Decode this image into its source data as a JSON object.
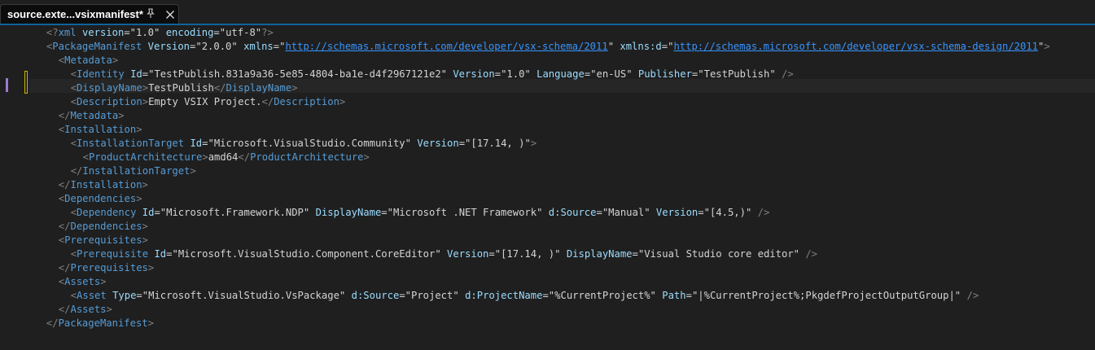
{
  "tab": {
    "title": "source.exte...vsixmanifest*",
    "pin_icon": "pin-icon",
    "close_icon": "close-icon"
  },
  "colors": {
    "tag": "#569cd6",
    "attribute": "#9cdcfe",
    "bracket": "#808080",
    "link": "#3794ff",
    "text": "#d4d4d4",
    "tab_accent": "#0e639c"
  },
  "code_lines": [
    {
      "indent": 2,
      "tokens": [
        [
          "br",
          "<?"
        ],
        [
          "tag",
          "xml"
        ],
        [
          "sp",
          " "
        ],
        [
          "attr",
          "version"
        ],
        [
          "eq",
          "="
        ],
        [
          "q",
          "\""
        ],
        [
          "val",
          "1.0"
        ],
        [
          "q",
          "\""
        ],
        [
          "sp",
          " "
        ],
        [
          "attr",
          "encoding"
        ],
        [
          "eq",
          "="
        ],
        [
          "q",
          "\""
        ],
        [
          "val",
          "utf-8"
        ],
        [
          "q",
          "\""
        ],
        [
          "br",
          "?>"
        ]
      ]
    },
    {
      "indent": 2,
      "tokens": [
        [
          "br",
          "<"
        ],
        [
          "tag",
          "PackageManifest"
        ],
        [
          "sp",
          " "
        ],
        [
          "attr",
          "Version"
        ],
        [
          "eq",
          "="
        ],
        [
          "q",
          "\""
        ],
        [
          "val",
          "2.0.0"
        ],
        [
          "q",
          "\""
        ],
        [
          "sp",
          " "
        ],
        [
          "attr",
          "xmlns"
        ],
        [
          "eq",
          "="
        ],
        [
          "q",
          "\""
        ],
        [
          "link",
          "http://schemas.microsoft.com/developer/vsx-schema/2011"
        ],
        [
          "q",
          "\""
        ],
        [
          "sp",
          " "
        ],
        [
          "attr",
          "xmlns:d"
        ],
        [
          "eq",
          "="
        ],
        [
          "q",
          "\""
        ],
        [
          "link",
          "http://schemas.microsoft.com/developer/vsx-schema-design/2011"
        ],
        [
          "q",
          "\""
        ],
        [
          "br",
          ">"
        ]
      ]
    },
    {
      "indent": 4,
      "tokens": [
        [
          "br",
          "<"
        ],
        [
          "tag",
          "Metadata"
        ],
        [
          "br",
          ">"
        ]
      ]
    },
    {
      "indent": 6,
      "tokens": [
        [
          "br",
          "<"
        ],
        [
          "tag",
          "Identity"
        ],
        [
          "sp",
          " "
        ],
        [
          "attr",
          "Id"
        ],
        [
          "eq",
          "="
        ],
        [
          "q",
          "\""
        ],
        [
          "val",
          "TestPublish.831a9a36-5e85-4804-ba1e-d4f2967121e2"
        ],
        [
          "q",
          "\""
        ],
        [
          "sp",
          " "
        ],
        [
          "attr",
          "Version"
        ],
        [
          "eq",
          "="
        ],
        [
          "q",
          "\""
        ],
        [
          "val",
          "1.0"
        ],
        [
          "q",
          "\""
        ],
        [
          "sp",
          " "
        ],
        [
          "attr",
          "Language"
        ],
        [
          "eq",
          "="
        ],
        [
          "q",
          "\""
        ],
        [
          "val",
          "en-US"
        ],
        [
          "q",
          "\""
        ],
        [
          "sp",
          " "
        ],
        [
          "attr",
          "Publisher"
        ],
        [
          "eq",
          "="
        ],
        [
          "q",
          "\""
        ],
        [
          "val",
          "TestPublish"
        ],
        [
          "q",
          "\""
        ],
        [
          "sp",
          " "
        ],
        [
          "br",
          "/>"
        ]
      ]
    },
    {
      "indent": 6,
      "tokens": [
        [
          "br",
          "<"
        ],
        [
          "tag",
          "DisplayName"
        ],
        [
          "br",
          ">"
        ],
        [
          "text",
          "TestPublish"
        ],
        [
          "br",
          "</"
        ],
        [
          "tag",
          "DisplayName"
        ],
        [
          "br",
          ">"
        ]
      ]
    },
    {
      "indent": 6,
      "tokens": [
        [
          "br",
          "<"
        ],
        [
          "tag",
          "Description"
        ],
        [
          "br",
          ">"
        ],
        [
          "text",
          "Empty VSIX Project."
        ],
        [
          "br",
          "</"
        ],
        [
          "tag",
          "Description"
        ],
        [
          "br",
          ">"
        ]
      ]
    },
    {
      "indent": 4,
      "tokens": [
        [
          "br",
          "</"
        ],
        [
          "tag",
          "Metadata"
        ],
        [
          "br",
          ">"
        ]
      ]
    },
    {
      "indent": 4,
      "tokens": [
        [
          "br",
          "<"
        ],
        [
          "tag",
          "Installation"
        ],
        [
          "br",
          ">"
        ]
      ]
    },
    {
      "indent": 6,
      "tokens": [
        [
          "br",
          "<"
        ],
        [
          "tag",
          "InstallationTarget"
        ],
        [
          "sp",
          " "
        ],
        [
          "attr",
          "Id"
        ],
        [
          "eq",
          "="
        ],
        [
          "q",
          "\""
        ],
        [
          "val",
          "Microsoft.VisualStudio.Community"
        ],
        [
          "q",
          "\""
        ],
        [
          "sp",
          " "
        ],
        [
          "attr",
          "Version"
        ],
        [
          "eq",
          "="
        ],
        [
          "q",
          "\""
        ],
        [
          "val",
          "[17.14, )"
        ],
        [
          "q",
          "\""
        ],
        [
          "br",
          ">"
        ]
      ]
    },
    {
      "indent": 8,
      "tokens": [
        [
          "br",
          "<"
        ],
        [
          "tag",
          "ProductArchitecture"
        ],
        [
          "br",
          ">"
        ],
        [
          "text",
          "amd64"
        ],
        [
          "br",
          "</"
        ],
        [
          "tag",
          "ProductArchitecture"
        ],
        [
          "br",
          ">"
        ]
      ]
    },
    {
      "indent": 6,
      "tokens": [
        [
          "br",
          "</"
        ],
        [
          "tag",
          "InstallationTarget"
        ],
        [
          "br",
          ">"
        ]
      ]
    },
    {
      "indent": 4,
      "tokens": [
        [
          "br",
          "</"
        ],
        [
          "tag",
          "Installation"
        ],
        [
          "br",
          ">"
        ]
      ]
    },
    {
      "indent": 4,
      "tokens": [
        [
          "br",
          "<"
        ],
        [
          "tag",
          "Dependencies"
        ],
        [
          "br",
          ">"
        ]
      ]
    },
    {
      "indent": 6,
      "tokens": [
        [
          "br",
          "<"
        ],
        [
          "tag",
          "Dependency"
        ],
        [
          "sp",
          " "
        ],
        [
          "attr",
          "Id"
        ],
        [
          "eq",
          "="
        ],
        [
          "q",
          "\""
        ],
        [
          "val",
          "Microsoft.Framework.NDP"
        ],
        [
          "q",
          "\""
        ],
        [
          "sp",
          " "
        ],
        [
          "attr",
          "DisplayName"
        ],
        [
          "eq",
          "="
        ],
        [
          "q",
          "\""
        ],
        [
          "val",
          "Microsoft .NET Framework"
        ],
        [
          "q",
          "\""
        ],
        [
          "sp",
          " "
        ],
        [
          "attr",
          "d:Source"
        ],
        [
          "eq",
          "="
        ],
        [
          "q",
          "\""
        ],
        [
          "val",
          "Manual"
        ],
        [
          "q",
          "\""
        ],
        [
          "sp",
          " "
        ],
        [
          "attr",
          "Version"
        ],
        [
          "eq",
          "="
        ],
        [
          "q",
          "\""
        ],
        [
          "val",
          "[4.5,)"
        ],
        [
          "q",
          "\""
        ],
        [
          "sp",
          " "
        ],
        [
          "br",
          "/>"
        ]
      ]
    },
    {
      "indent": 4,
      "tokens": [
        [
          "br",
          "</"
        ],
        [
          "tag",
          "Dependencies"
        ],
        [
          "br",
          ">"
        ]
      ]
    },
    {
      "indent": 4,
      "tokens": [
        [
          "br",
          "<"
        ],
        [
          "tag",
          "Prerequisites"
        ],
        [
          "br",
          ">"
        ]
      ]
    },
    {
      "indent": 6,
      "tokens": [
        [
          "br",
          "<"
        ],
        [
          "tag",
          "Prerequisite"
        ],
        [
          "sp",
          " "
        ],
        [
          "attr",
          "Id"
        ],
        [
          "eq",
          "="
        ],
        [
          "q",
          "\""
        ],
        [
          "val",
          "Microsoft.VisualStudio.Component.CoreEditor"
        ],
        [
          "q",
          "\""
        ],
        [
          "sp",
          " "
        ],
        [
          "attr",
          "Version"
        ],
        [
          "eq",
          "="
        ],
        [
          "q",
          "\""
        ],
        [
          "val",
          "[17.14, )"
        ],
        [
          "q",
          "\""
        ],
        [
          "sp",
          " "
        ],
        [
          "attr",
          "DisplayName"
        ],
        [
          "eq",
          "="
        ],
        [
          "q",
          "\""
        ],
        [
          "val",
          "Visual Studio core editor"
        ],
        [
          "q",
          "\""
        ],
        [
          "sp",
          " "
        ],
        [
          "br",
          "/>"
        ]
      ]
    },
    {
      "indent": 4,
      "tokens": [
        [
          "br",
          "</"
        ],
        [
          "tag",
          "Prerequisites"
        ],
        [
          "br",
          ">"
        ]
      ]
    },
    {
      "indent": 4,
      "tokens": [
        [
          "br",
          "<"
        ],
        [
          "tag",
          "Assets"
        ],
        [
          "br",
          ">"
        ]
      ]
    },
    {
      "indent": 6,
      "tokens": [
        [
          "br",
          "<"
        ],
        [
          "tag",
          "Asset"
        ],
        [
          "sp",
          " "
        ],
        [
          "attr",
          "Type"
        ],
        [
          "eq",
          "="
        ],
        [
          "q",
          "\""
        ],
        [
          "val",
          "Microsoft.VisualStudio.VsPackage"
        ],
        [
          "q",
          "\""
        ],
        [
          "sp",
          " "
        ],
        [
          "attr",
          "d:Source"
        ],
        [
          "eq",
          "="
        ],
        [
          "q",
          "\""
        ],
        [
          "val",
          "Project"
        ],
        [
          "q",
          "\""
        ],
        [
          "sp",
          " "
        ],
        [
          "attr",
          "d:ProjectName"
        ],
        [
          "eq",
          "="
        ],
        [
          "q",
          "\""
        ],
        [
          "val",
          "%CurrentProject%"
        ],
        [
          "q",
          "\""
        ],
        [
          "sp",
          " "
        ],
        [
          "attr",
          "Path"
        ],
        [
          "eq",
          "="
        ],
        [
          "q",
          "\""
        ],
        [
          "val",
          "|%CurrentProject%;PkgdefProjectOutputGroup|"
        ],
        [
          "q",
          "\""
        ],
        [
          "sp",
          " "
        ],
        [
          "br",
          "/>"
        ]
      ]
    },
    {
      "indent": 4,
      "tokens": [
        [
          "br",
          "</"
        ],
        [
          "tag",
          "Assets"
        ],
        [
          "br",
          ">"
        ]
      ]
    },
    {
      "indent": 2,
      "tokens": [
        [
          "br",
          "</"
        ],
        [
          "tag",
          "PackageManifest"
        ],
        [
          "br",
          ">"
        ]
      ]
    }
  ]
}
